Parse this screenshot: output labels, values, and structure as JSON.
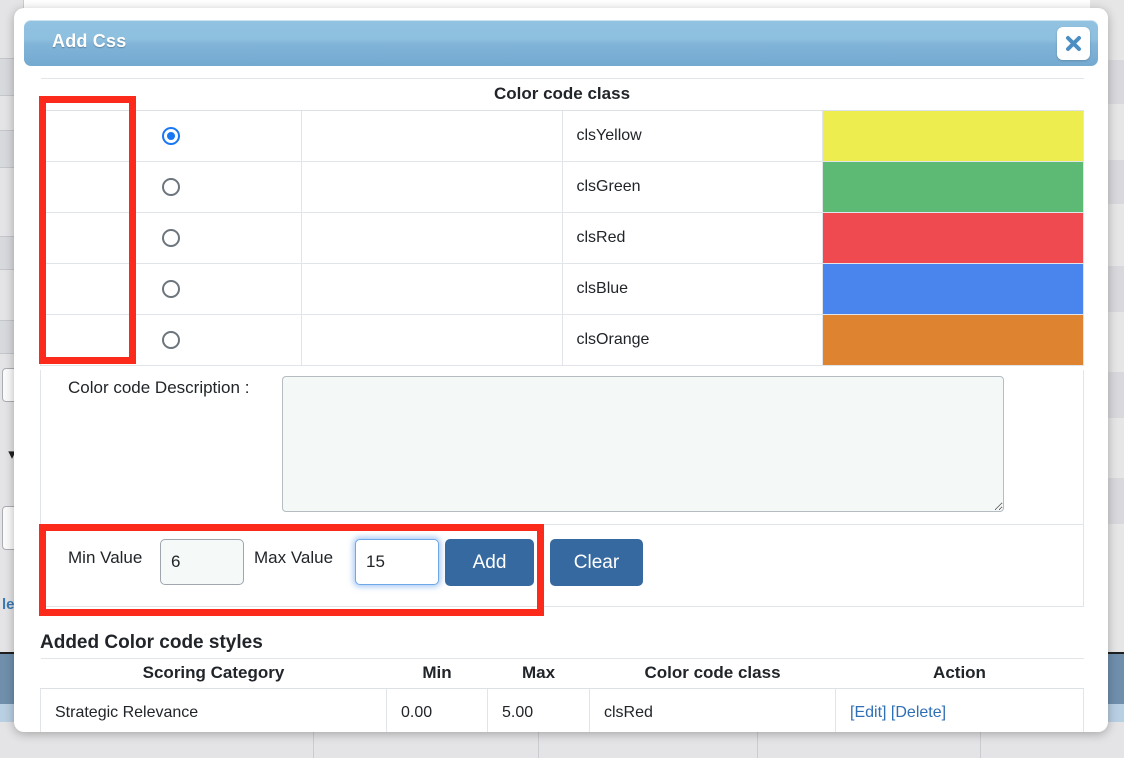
{
  "modal": {
    "title": "Add Css",
    "close_icon": "close-x-icon",
    "close_label": "✕"
  },
  "color_table": {
    "header": "Color code class",
    "rows": [
      {
        "class_name": "clsYellow",
        "color": "#eded4f",
        "selected": true
      },
      {
        "class_name": "clsGreen",
        "color": "#5cba74",
        "selected": false
      },
      {
        "class_name": "clsRed",
        "color": "#ef4a4f",
        "selected": false
      },
      {
        "class_name": "clsBlue",
        "color": "#4a85ed",
        "selected": false
      },
      {
        "class_name": "clsOrange",
        "color": "#de8330",
        "selected": false
      }
    ]
  },
  "description": {
    "label": "Color code Description :",
    "value": "",
    "placeholder": ""
  },
  "minmax": {
    "min_label": "Min Value",
    "min_value": "6",
    "max_label": "Max Value",
    "max_value": "15",
    "add_label": "Add",
    "clear_label": "Clear"
  },
  "added_section": {
    "title": "Added Color code styles",
    "columns": [
      "Scoring Category",
      "Min",
      "Max",
      "Color code class",
      "Action"
    ],
    "rows": [
      {
        "scoring_category": "Strategic Relevance",
        "min": "0.00",
        "max": "5.00",
        "color_code_class": "clsRed",
        "edit_label": "[Edit]",
        "delete_label": "[Delete]"
      }
    ]
  },
  "annotations": {
    "radio_box_color": "#fc2a1b",
    "minmax_box_color": "#fc2a1b"
  },
  "theme": {
    "header_blue": "#85b9db",
    "button_blue": "#36699f",
    "link_blue": "#2f6fb5",
    "focus_blue": "#6fa8e8"
  },
  "background": {
    "link_fragment": "le",
    "chevron_icon": "chevron-down-icon"
  }
}
